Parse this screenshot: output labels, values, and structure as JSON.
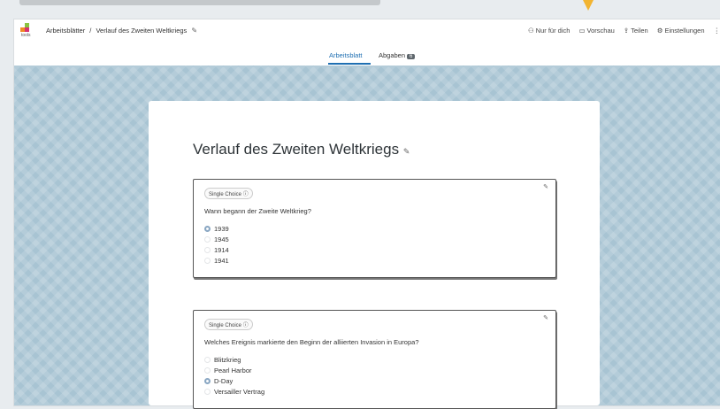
{
  "header": {
    "logo_text": "tools",
    "breadcrumb": [
      "Arbeitsblätter",
      "/",
      "Verlauf des Zweiten Weltkriegs"
    ],
    "actions": [
      "Nur für dich",
      "Vorschau",
      "Teilen",
      "Einstellungen"
    ]
  },
  "tabs": [
    {
      "label": "Arbeitsblatt",
      "active": true
    },
    {
      "label": "Abgaben",
      "badge": "6"
    }
  ],
  "sheet": {
    "title": "Verlauf des Zweiten Weltkriegs",
    "questions": [
      {
        "type_label": "Single Choice ⓘ",
        "text": "Wann begann der Zweite Weltkrieg?",
        "options": [
          "1939",
          "1945",
          "1914",
          "1941"
        ],
        "selected": 0
      },
      {
        "type_label": "Single Choice ⓘ",
        "text": "Welches Ereignis markierte den Beginn der alliierten Invasion in Europa?",
        "options": [
          "Blitzkrieg",
          "Pearl Harbor",
          "D-Day",
          "Versailler Vertrag"
        ],
        "selected": 2
      }
    ]
  }
}
